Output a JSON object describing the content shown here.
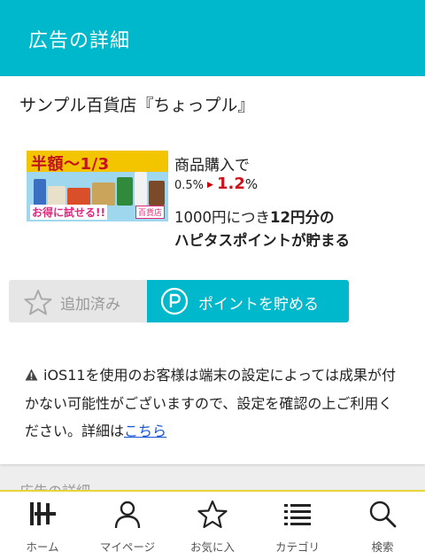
{
  "header": {
    "title": "広告の詳細"
  },
  "offer": {
    "shop_name": "サンプル百貨店『ちょっプル』",
    "banner": {
      "headline": "半額〜1/3",
      "tagline": "お得に試せる!!",
      "store_label": "百貨店"
    },
    "purchase_label": "商品購入で",
    "rate_old": "0.5%",
    "rate_new": "1.2",
    "rate_unit": "%",
    "reward_prefix": "1000円につき",
    "reward_bold": "12円分の",
    "reward_line2": "ハピタスポイントが貯まる"
  },
  "actions": {
    "added_label": "追加済み",
    "point_label": "ポイントを貯める"
  },
  "notice": {
    "text": "iOS11を使用のお客様は端末の設定によっては成果が付かない可能性がございますので、設定を確認の上ご利用ください。詳細は",
    "link_text": "こちら"
  },
  "next_section_peek": "広告の詳細",
  "tabbar": {
    "items": [
      {
        "label": "ホーム",
        "icon": "home-icon"
      },
      {
        "label": "マイページ",
        "icon": "person-icon"
      },
      {
        "label": "お気に入",
        "icon": "star-icon"
      },
      {
        "label": "カテゴリ",
        "icon": "list-icon"
      },
      {
        "label": "検索",
        "icon": "search-icon"
      }
    ]
  },
  "colors": {
    "accent": "#00b8cc",
    "rate_red": "#d0111b",
    "link": "#1a55d6"
  }
}
